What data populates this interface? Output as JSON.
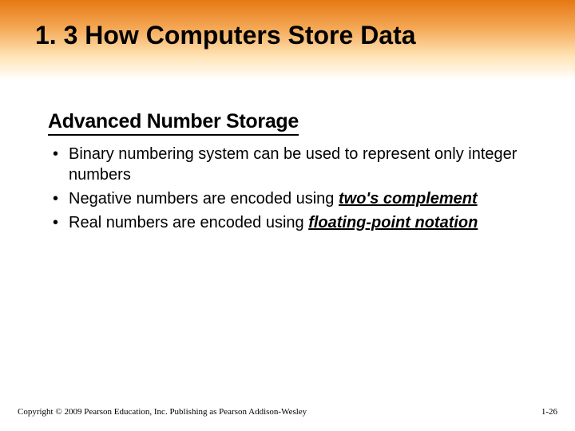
{
  "title": "1. 3 How Computers Store Data",
  "subtitle": "Advanced Number Storage",
  "bullets": [
    {
      "pre": "Binary numbering system can be used to represent only integer numbers",
      "term": "",
      "post": ""
    },
    {
      "pre": "Negative numbers are encoded using ",
      "term": "two's complement",
      "post": ""
    },
    {
      "pre": "Real numbers are encoded using ",
      "term": "floating-point notation",
      "post": ""
    }
  ],
  "footer": {
    "copyright": "Copyright © 2009 Pearson Education, Inc. Publishing as Pearson Addison-Wesley",
    "pagenum": "1-26"
  }
}
